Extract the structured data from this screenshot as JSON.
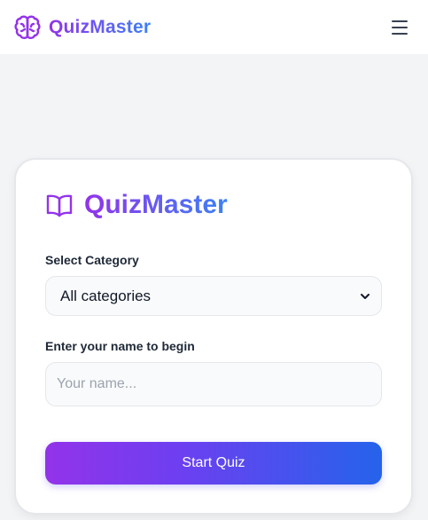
{
  "navbar": {
    "brand_name": "QuizMaster",
    "brand_icon": "brain-icon",
    "menu_icon": "hamburger-menu-icon"
  },
  "card": {
    "title": "QuizMaster",
    "title_icon": "book-open-icon",
    "category_label": "Select Category",
    "category_selected": "All categories",
    "name_label": "Enter your name to begin",
    "name_value": "",
    "name_placeholder": "Your name...",
    "start_button_label": "Start Quiz"
  },
  "colors": {
    "accent_purple": "#9333ea",
    "accent_blue": "#2563eb",
    "page_background": "#f3f4f6"
  }
}
